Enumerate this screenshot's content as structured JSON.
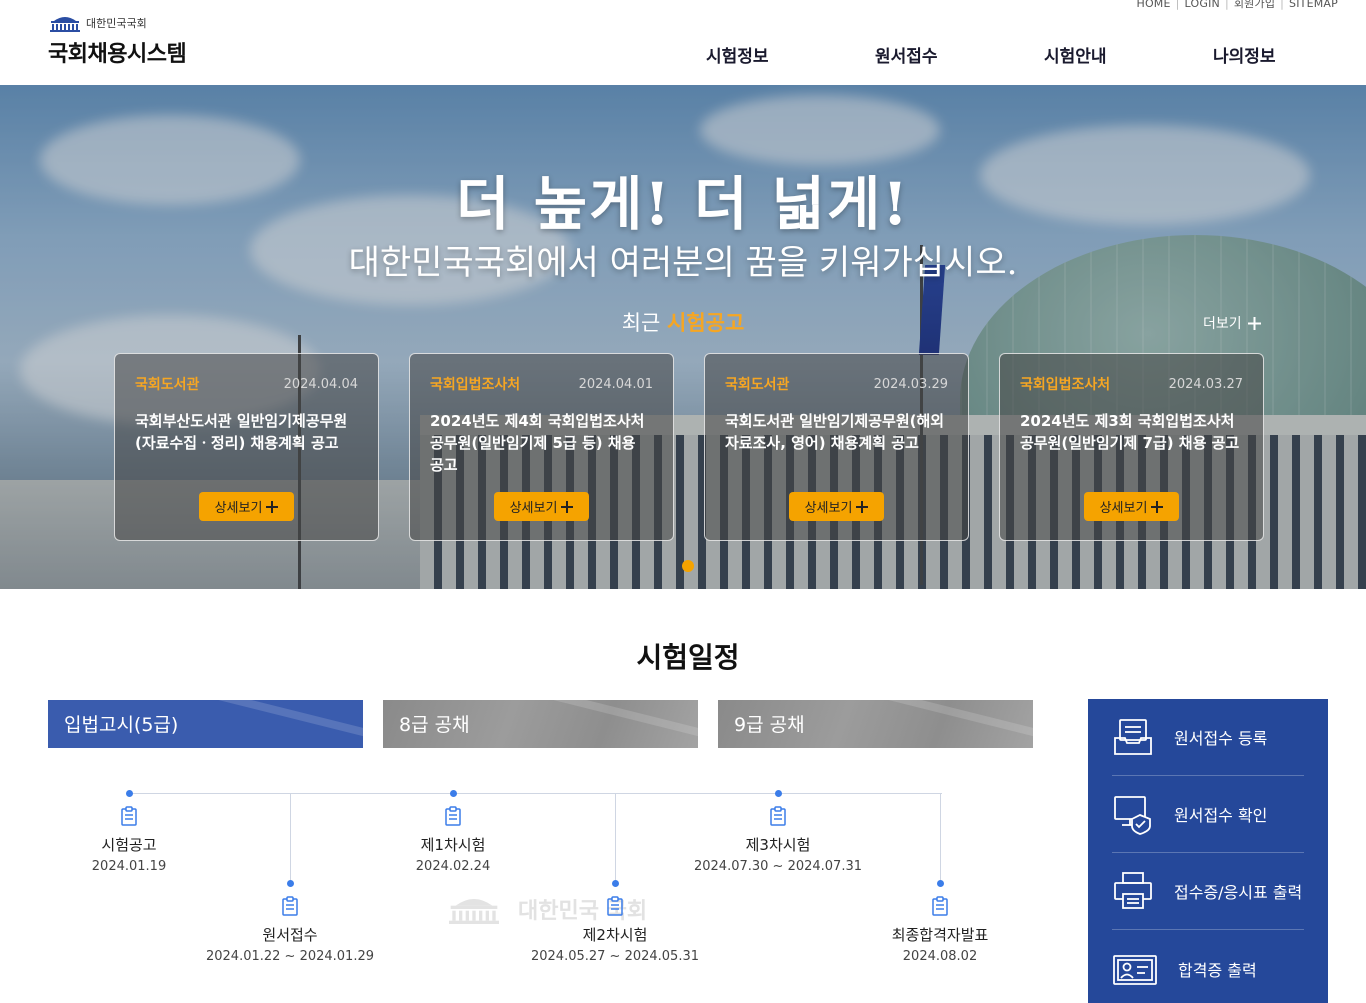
{
  "header": {
    "util_links": [
      "HOME",
      "LOGIN",
      "회원가입",
      "SITEMAP"
    ],
    "logo_small": "대한민국국회",
    "logo_title": "국회채용시스템",
    "nav": [
      "시험정보",
      "원서접수",
      "시험안내",
      "나의정보"
    ]
  },
  "hero": {
    "title": "더 높게! 더 넓게!",
    "subtitle": "대한민국국회에서 여러분의 꿈을 키워가십시오.",
    "recent_prefix": "최근",
    "recent_highlight": "시험공고",
    "more_label": "더보기",
    "cards": [
      {
        "org": "국회도서관",
        "date": "2024.04.04",
        "title": "국회부산도서관 일반임기제공무원(자료수집ㆍ정리) 채용계획 공고",
        "button": "상세보기"
      },
      {
        "org": "국회입법조사처",
        "date": "2024.04.01",
        "title": "2024년도 제4회 국회입법조사처 공무원(일반임기제 5급 등) 채용 공고",
        "button": "상세보기"
      },
      {
        "org": "국회도서관",
        "date": "2024.03.29",
        "title": "국회도서관 일반임기제공무원(해외자료조사, 영어) 채용계획 공고",
        "button": "상세보기"
      },
      {
        "org": "국회입법조사처",
        "date": "2024.03.27",
        "title": "2024년도 제3회 국회입법조사처 공무원(일반임기제 7급) 채용 공고",
        "button": "상세보기"
      }
    ],
    "accent_color": "#f5a300"
  },
  "schedule": {
    "title": "시험일정",
    "tabs": [
      {
        "label": "입법고시(5급)",
        "active": true
      },
      {
        "label": "8급 공채",
        "active": false
      },
      {
        "label": "9급 공채",
        "active": false
      }
    ],
    "timeline": [
      {
        "label": "시험공고",
        "date": "2024.01.19"
      },
      {
        "label": "원서접수",
        "date": "2024.01.22 ~ 2024.01.29"
      },
      {
        "label": "제1차시험",
        "date": "2024.02.24"
      },
      {
        "label": "제2차시험",
        "date": "2024.05.27 ~ 2024.05.31"
      },
      {
        "label": "제3차시험",
        "date": "2024.07.30 ~ 2024.07.31"
      },
      {
        "label": "최종합격자발표",
        "date": "2024.08.02"
      }
    ],
    "watermark": "대한민국 국회"
  },
  "quick_menu": [
    {
      "label": "원서접수 등록",
      "icon": "tray-icon"
    },
    {
      "label": "원서접수 확인",
      "icon": "monitor-check-icon"
    },
    {
      "label": "접수증/응시표 출력",
      "icon": "printer-icon"
    },
    {
      "label": "합격증 출력",
      "icon": "id-card-icon"
    }
  ],
  "colors": {
    "primary": "#25489a",
    "tab_active": "#3a5cae",
    "timeline_dot": "#3b7de9"
  }
}
